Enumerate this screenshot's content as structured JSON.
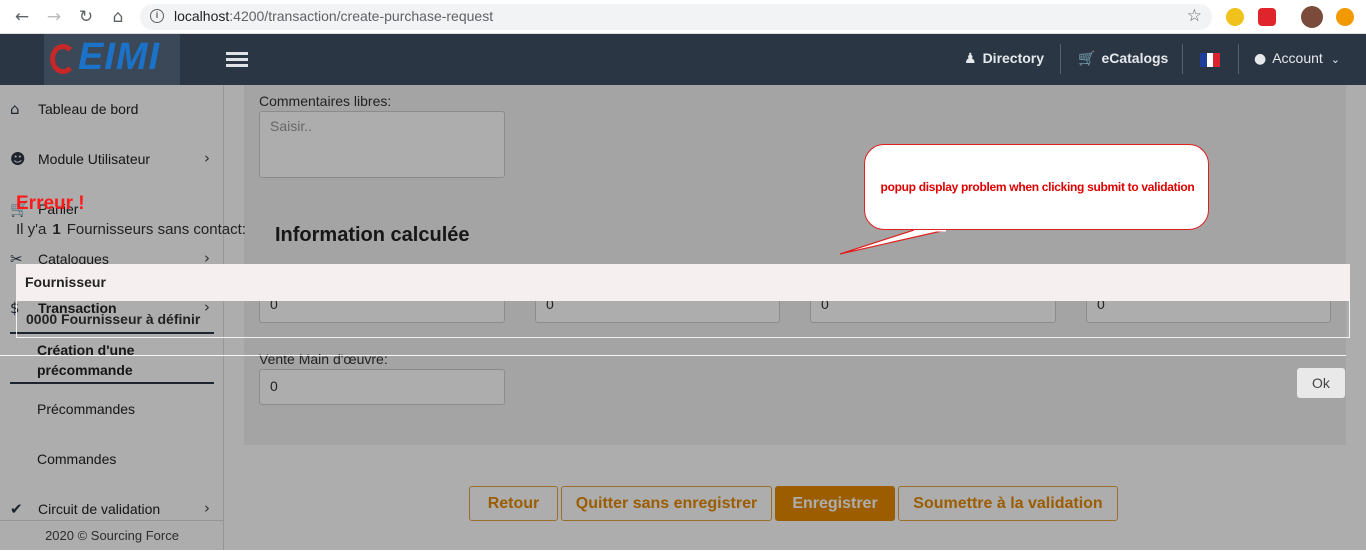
{
  "browser": {
    "url_host": "localhost",
    "url_path": ":4200/transaction/create-purchase-request"
  },
  "header": {
    "logo": "EIMI",
    "directory": "Directory",
    "ecatalogs": "eCatalogs",
    "account": "Account"
  },
  "sidebar": {
    "items": [
      {
        "label": "Tableau de bord",
        "icon": "home-icon"
      },
      {
        "label": "Module Utilisateur",
        "icon": "users-icon"
      },
      {
        "label": "Panier",
        "icon": "cart-icon"
      },
      {
        "label": "Catalogues",
        "icon": "tools-icon"
      },
      {
        "label": "Transaction",
        "icon": "dollar-icon"
      }
    ],
    "sub_items": [
      {
        "label": "Création d'une précommande"
      },
      {
        "label": "Précommandes"
      },
      {
        "label": "Commandes"
      }
    ],
    "validation": "Circuit de validation",
    "footer": "2020 © Sourcing Force"
  },
  "form": {
    "comments_label": "Commentaires libres:",
    "comments_placeholder": "Saisir..",
    "section_title": "Information calculée",
    "values": [
      "0",
      "0",
      "0",
      "0"
    ],
    "labor_label": "Vente Main d'œuvre:",
    "labor_value": "0"
  },
  "buttons": {
    "back": "Retour",
    "quit": "Quitter sans enregistrer",
    "save": "Enregistrer",
    "submit": "Soumettre à la validation"
  },
  "popup": {
    "title": "Erreur !",
    "message_prefix": "Il y'a",
    "count": "1",
    "message_suffix": "Fournisseurs sans contact:",
    "column_header": "Fournisseur",
    "row": "0000 Fournisseur à définir",
    "ok": "Ok"
  },
  "annotation": {
    "text": "popup display problem when clicking submit to validation"
  },
  "colors": {
    "header_bg": "#2b3644",
    "accent": "#e58a00",
    "error": "#ff1a1a"
  }
}
